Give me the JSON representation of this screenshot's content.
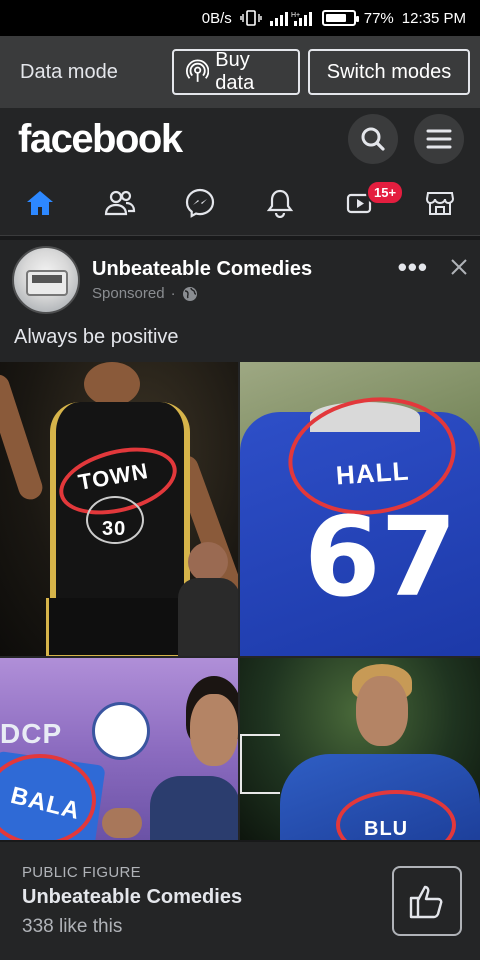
{
  "status_bar": {
    "speed": "0B/s",
    "battery": "77%",
    "battery_level": 0.77,
    "time": "12:35 PM"
  },
  "data_mode": {
    "title": "Data mode",
    "buy_label": "Buy data",
    "switch_label": "Switch modes"
  },
  "header": {
    "logo": "facebook"
  },
  "tabs": {
    "items": [
      "home-icon",
      "friends-icon",
      "messenger-icon",
      "bell-icon",
      "video-icon",
      "marketplace-icon"
    ],
    "video_badge": "15+",
    "accent": "#2d88ff"
  },
  "post": {
    "author": "Unbeateable Comedies",
    "meta": "Sponsored",
    "caption": "Always be positive",
    "photos": {
      "p1_text": "TOWN",
      "p1_number": "30",
      "p2_text": "HALL",
      "p2_number": "67",
      "p3_sign": "DCP",
      "p3_text": "BALA",
      "p4_text": "BLU"
    }
  },
  "page_card": {
    "label": "PUBLIC FIGURE",
    "name": "Unbeateable Comedies",
    "likes": "338 like this"
  }
}
